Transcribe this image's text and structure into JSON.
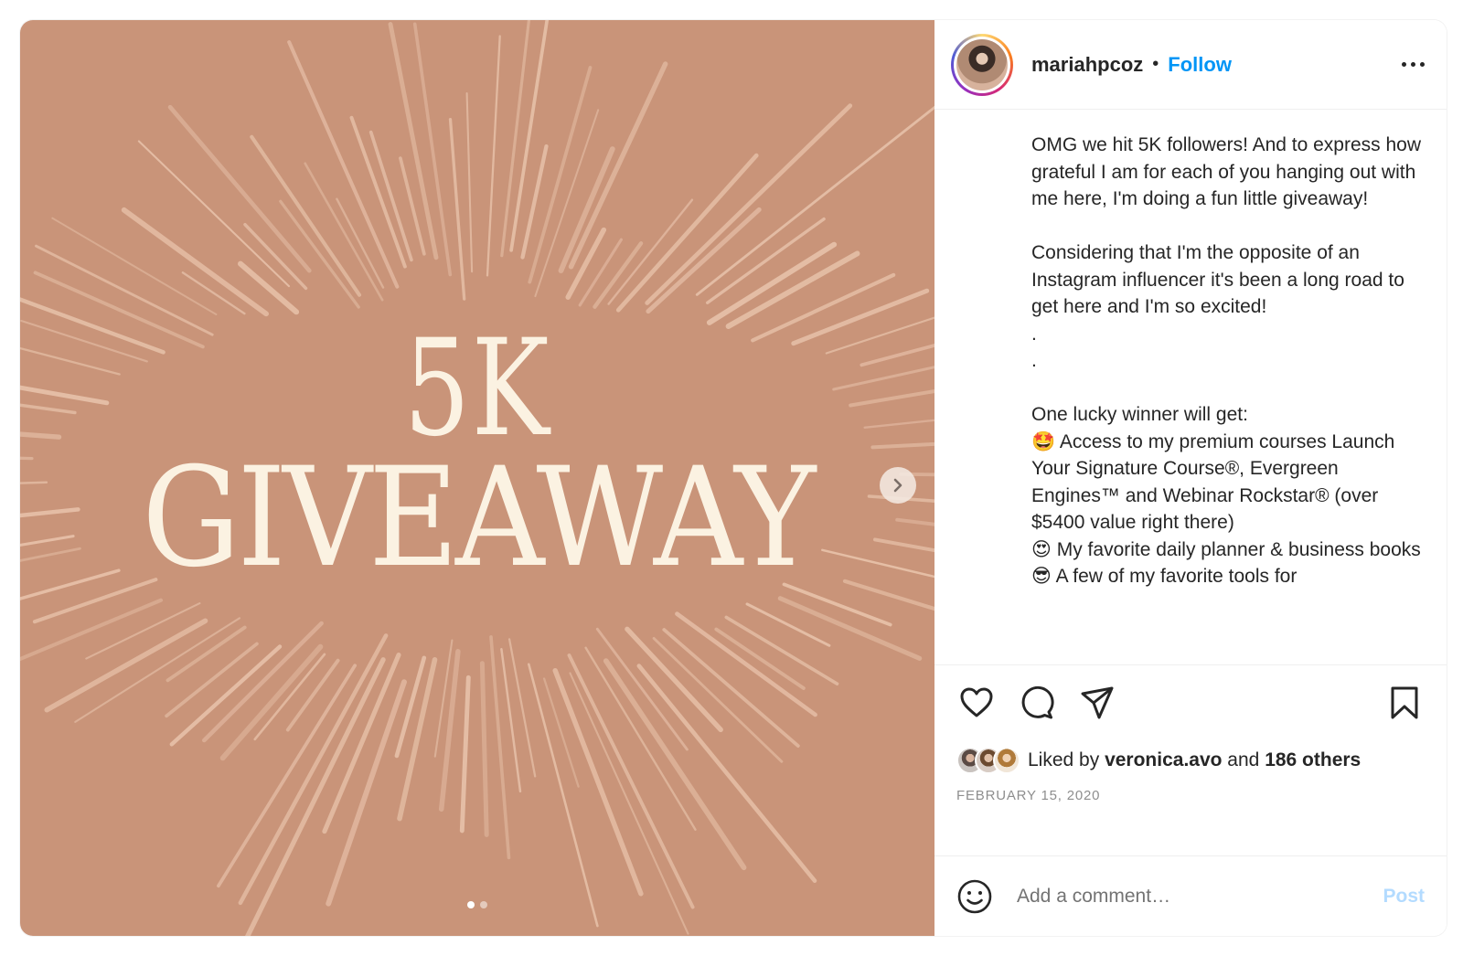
{
  "media": {
    "headline_top": "5K",
    "headline_bottom": "GIVEAWAY",
    "background_color": "#c99479",
    "text_color": "#fbf2e2",
    "carousel_position": 1,
    "carousel_total": 2,
    "next_icon": "chevron-right-icon"
  },
  "header": {
    "username": "mariahpcoz",
    "separator": "•",
    "follow_label": "Follow",
    "more_icon": "more-horizontal-icon"
  },
  "caption": {
    "text": "OMG we hit 5K followers! And to express how grateful I am for each of you hanging out with me here, I'm doing a fun little giveaway!\n\nConsidering that I'm the opposite of an Instagram influencer it's been a long road to get here and I'm so excited!\n.\n.\n\nOne lucky winner will get:\n🤩 Access to my premium courses Launch Your Signature Course®, Evergreen Engines™ and Webinar Rockstar® (over $5400 value right there)\n😍 My favorite daily planner & business books\n😎 A few of my favorite tools for"
  },
  "actions": {
    "like_icon": "heart-icon",
    "comment_icon": "comment-icon",
    "share_icon": "send-icon",
    "save_icon": "bookmark-icon"
  },
  "likes": {
    "prefix": "Liked by ",
    "user": "veronica.avo",
    "middle": " and ",
    "others": "186 others"
  },
  "date": "FEBRUARY 15, 2020",
  "comment": {
    "placeholder": "Add a comment…",
    "post_label": "Post",
    "emoji_icon": "smiley-icon"
  },
  "colors": {
    "accent": "#0095f6",
    "post_disabled": "#b3dbff",
    "muted": "#8e8e8e"
  }
}
